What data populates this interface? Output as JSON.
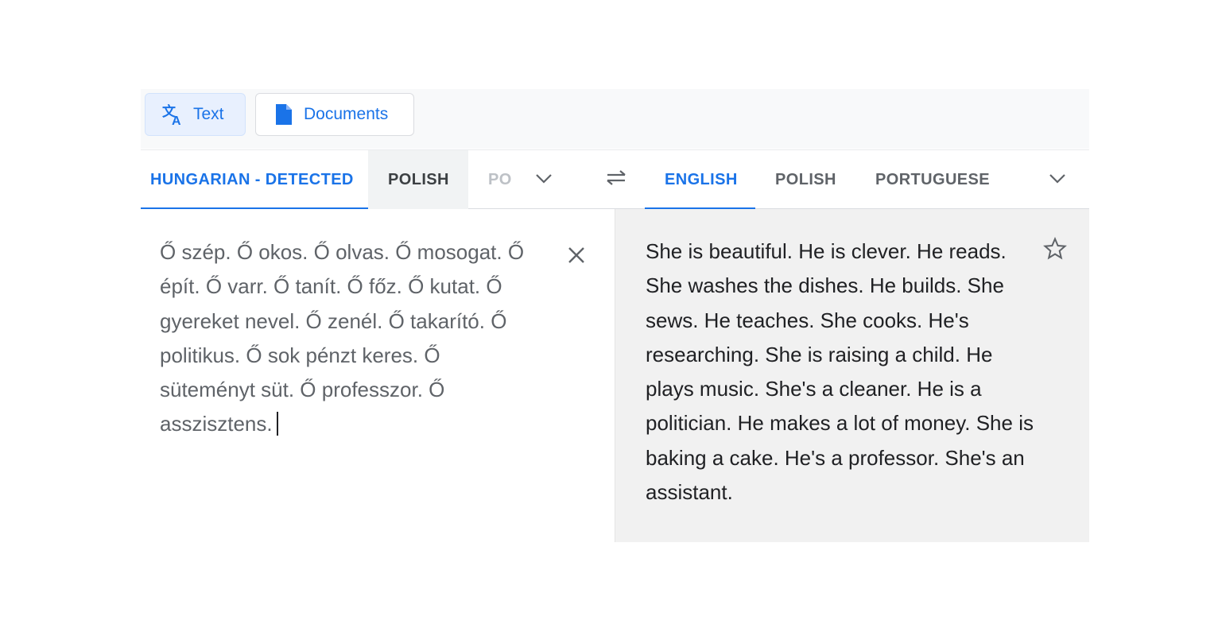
{
  "modes": {
    "text_label": "Text",
    "documents_label": "Documents",
    "accent_color": "#1a73e8"
  },
  "source_languages": {
    "tabs": [
      {
        "label": "HUNGARIAN - DETECTED",
        "selected": true
      },
      {
        "label": "POLISH",
        "selected": false
      },
      {
        "label": "PO",
        "selected": false
      }
    ],
    "more_icon": "chevron-down-icon"
  },
  "swap_icon": "swap-languages-icon",
  "target_languages": {
    "tabs": [
      {
        "label": "ENGLISH",
        "selected": true
      },
      {
        "label": "POLISH",
        "selected": false
      },
      {
        "label": "PORTUGUESE",
        "selected": false
      }
    ],
    "more_icon": "chevron-down-icon"
  },
  "source": {
    "text": "Ő szép. Ő okos. Ő olvas. Ő mosogat. Ő épít. Ő varr. Ő tanít. Ő főz. Ő kutat. Ő gyereket nevel. Ő zenél. Ő takarító. Ő politikus. Ő sok pénzt keres. Ő süteményt süt. Ő professzor. Ő asszisztens.",
    "clear_icon": "close-icon"
  },
  "translation": {
    "text": "She is beautiful. He is clever. He reads. She washes the dishes. He builds. She sews. He teaches. She cooks. He's researching. She is raising a child. He plays music. She's a cleaner. He is a politician. He makes a lot of money. She is baking a cake. He's a professor. She's an assistant.",
    "save_icon": "star-icon"
  }
}
